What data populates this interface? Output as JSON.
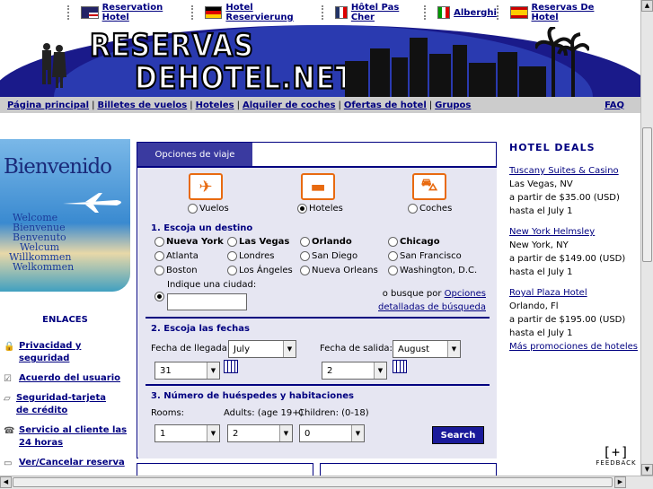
{
  "top_langs": [
    {
      "label": "Reservation Hotel",
      "flag": "usa"
    },
    {
      "label": "Hotel Reservierung",
      "flag": "germany"
    },
    {
      "label": "Hôtel Pas Cher",
      "flag": "france"
    },
    {
      "label": "Alberghi",
      "flag": "italy"
    },
    {
      "label": "Reservas De Hotel",
      "flag": "spain"
    }
  ],
  "logo": {
    "line1": "RESERVAS",
    "line2": "DEHOTEL.NET"
  },
  "nav": {
    "items": [
      "Página principal",
      "Billetes de vuelos",
      "Hoteles",
      "Alquiler de coches",
      "Ofertas de hotel",
      "Grupos"
    ],
    "faq": "FAQ"
  },
  "welcome": {
    "title": "Bienvenido",
    "words": [
      "Welcome",
      "Bienvenue",
      "Benvenuto",
      "Welcum",
      "Willkommen",
      "Welkommen"
    ]
  },
  "enlaces": {
    "title": "ENLACES",
    "links": [
      {
        "label": "Privacidad y seguridad",
        "icon": "lock-icon"
      },
      {
        "label": "Acuerdo del usuario",
        "icon": "check-doc-icon"
      },
      {
        "label": "Seguridad-tarjeta de crédito",
        "icon": "card-icon"
      },
      {
        "label": "Servicio al cliente las 24 horas",
        "icon": "phone-icon"
      },
      {
        "label": "Ver/Cancelar reserva",
        "icon": "computer-icon"
      }
    ]
  },
  "panel": {
    "tab": "Opciones de viaje",
    "types": [
      {
        "label": "Vuelos",
        "selected": false
      },
      {
        "label": "Hoteles",
        "selected": true
      },
      {
        "label": "Coches",
        "selected": false
      }
    ],
    "s1": "1. Escoja un destino",
    "cities": [
      "Nueva York",
      "Las Vegas",
      "Orlando",
      "Chicago",
      "Atlanta",
      "Londres",
      "San Diego",
      "San Francisco",
      "Boston",
      "Los Ángeles",
      "Nueva Orleans",
      "Washington, D.C."
    ],
    "other_city_label": "Indique una ciudad:",
    "other_city_value": "",
    "or_text": "o busque por",
    "detail_link": "Opciones detalladas de búsqueda",
    "s2": "2. Escoja las fechas",
    "arrival_label": "Fecha de llegada:",
    "arrival_month": "July",
    "arrival_day": "31",
    "departure_label": "Fecha de salida:",
    "departure_month": "August",
    "departure_day": "2",
    "s3": "3. Número de huéspedes y habitaciones",
    "rooms_label": "Rooms:",
    "rooms_value": "1",
    "adults_label": "Adults: (age 19+)",
    "adults_value": "2",
    "children_label": "Children: (0-18)",
    "children_value": "0",
    "search": "Search"
  },
  "deals": {
    "title": "HOTEL DEALS",
    "items": [
      {
        "name": "Tuscany Suites & Casino",
        "city": "Las Vegas, NV",
        "price": "a partir de $35.00 (USD)",
        "until": "hasta el July 1"
      },
      {
        "name": "New York Helmsley",
        "city": "New York, NY",
        "price": "a partir de $149.00 (USD)",
        "until": "hasta el July 1"
      },
      {
        "name": "Royal Plaza Hotel",
        "city": "Orlando, Fl",
        "price": "a partir de $195.00 (USD)",
        "until": "hasta el July 1"
      }
    ],
    "more": "Más promociones de hoteles"
  },
  "feedback": {
    "plus": "[+]",
    "label": "FEEDBACK"
  }
}
